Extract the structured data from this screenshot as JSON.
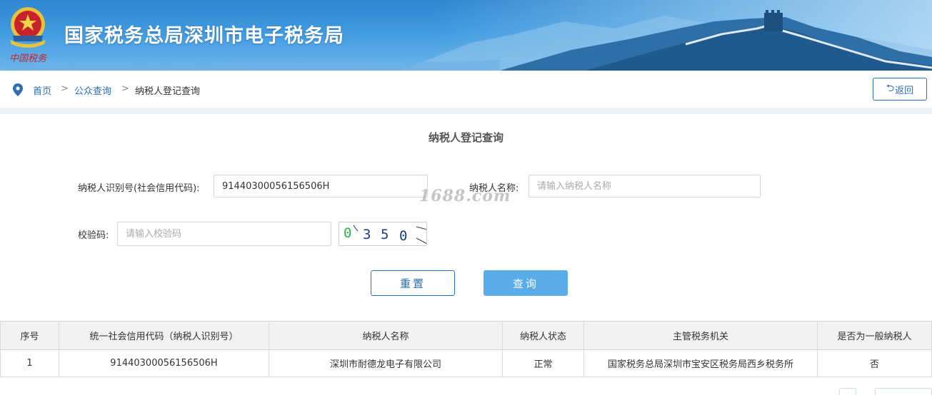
{
  "header": {
    "title": "国家税务总局深圳市电子税务局",
    "emblem_text": "中国税务"
  },
  "breadcrumb": {
    "items": [
      "首页",
      "公众查询",
      "纳税人登记查询"
    ],
    "separator": ">"
  },
  "back_button": {
    "icon": "return-arrow-icon",
    "label": "返回"
  },
  "form": {
    "title": "纳税人登记查询",
    "taxpayer_id_label": "纳税人识别号(社会信用代码):",
    "taxpayer_id_value": "91440300056156506H",
    "taxpayer_name_label": "纳税人名称:",
    "taxpayer_name_placeholder": "请输入纳税人名称",
    "captcha_label": "校验码:",
    "captcha_placeholder": "请输入校验码",
    "captcha_chars": [
      "0",
      "3",
      "5",
      "0"
    ],
    "reset_label": "重置",
    "query_label": "查询"
  },
  "watermark": "1688.com",
  "table": {
    "columns": [
      "序号",
      "统一社会信用代码（纳税人识别号）",
      "纳税人名称",
      "纳税人状态",
      "主管税务机关",
      "是否为一般纳税人"
    ],
    "rows": [
      [
        "1",
        "91440300056156506H",
        "深圳市耐德龙电子有限公司",
        "正常",
        "国家税务总局深圳市宝安区税务局西乡税务所",
        "否"
      ]
    ]
  },
  "colors": {
    "banner": "#3f9ae0",
    "link": "#2a6fb8",
    "query_button": "#5aace9",
    "divider": "#f0f1f3"
  }
}
